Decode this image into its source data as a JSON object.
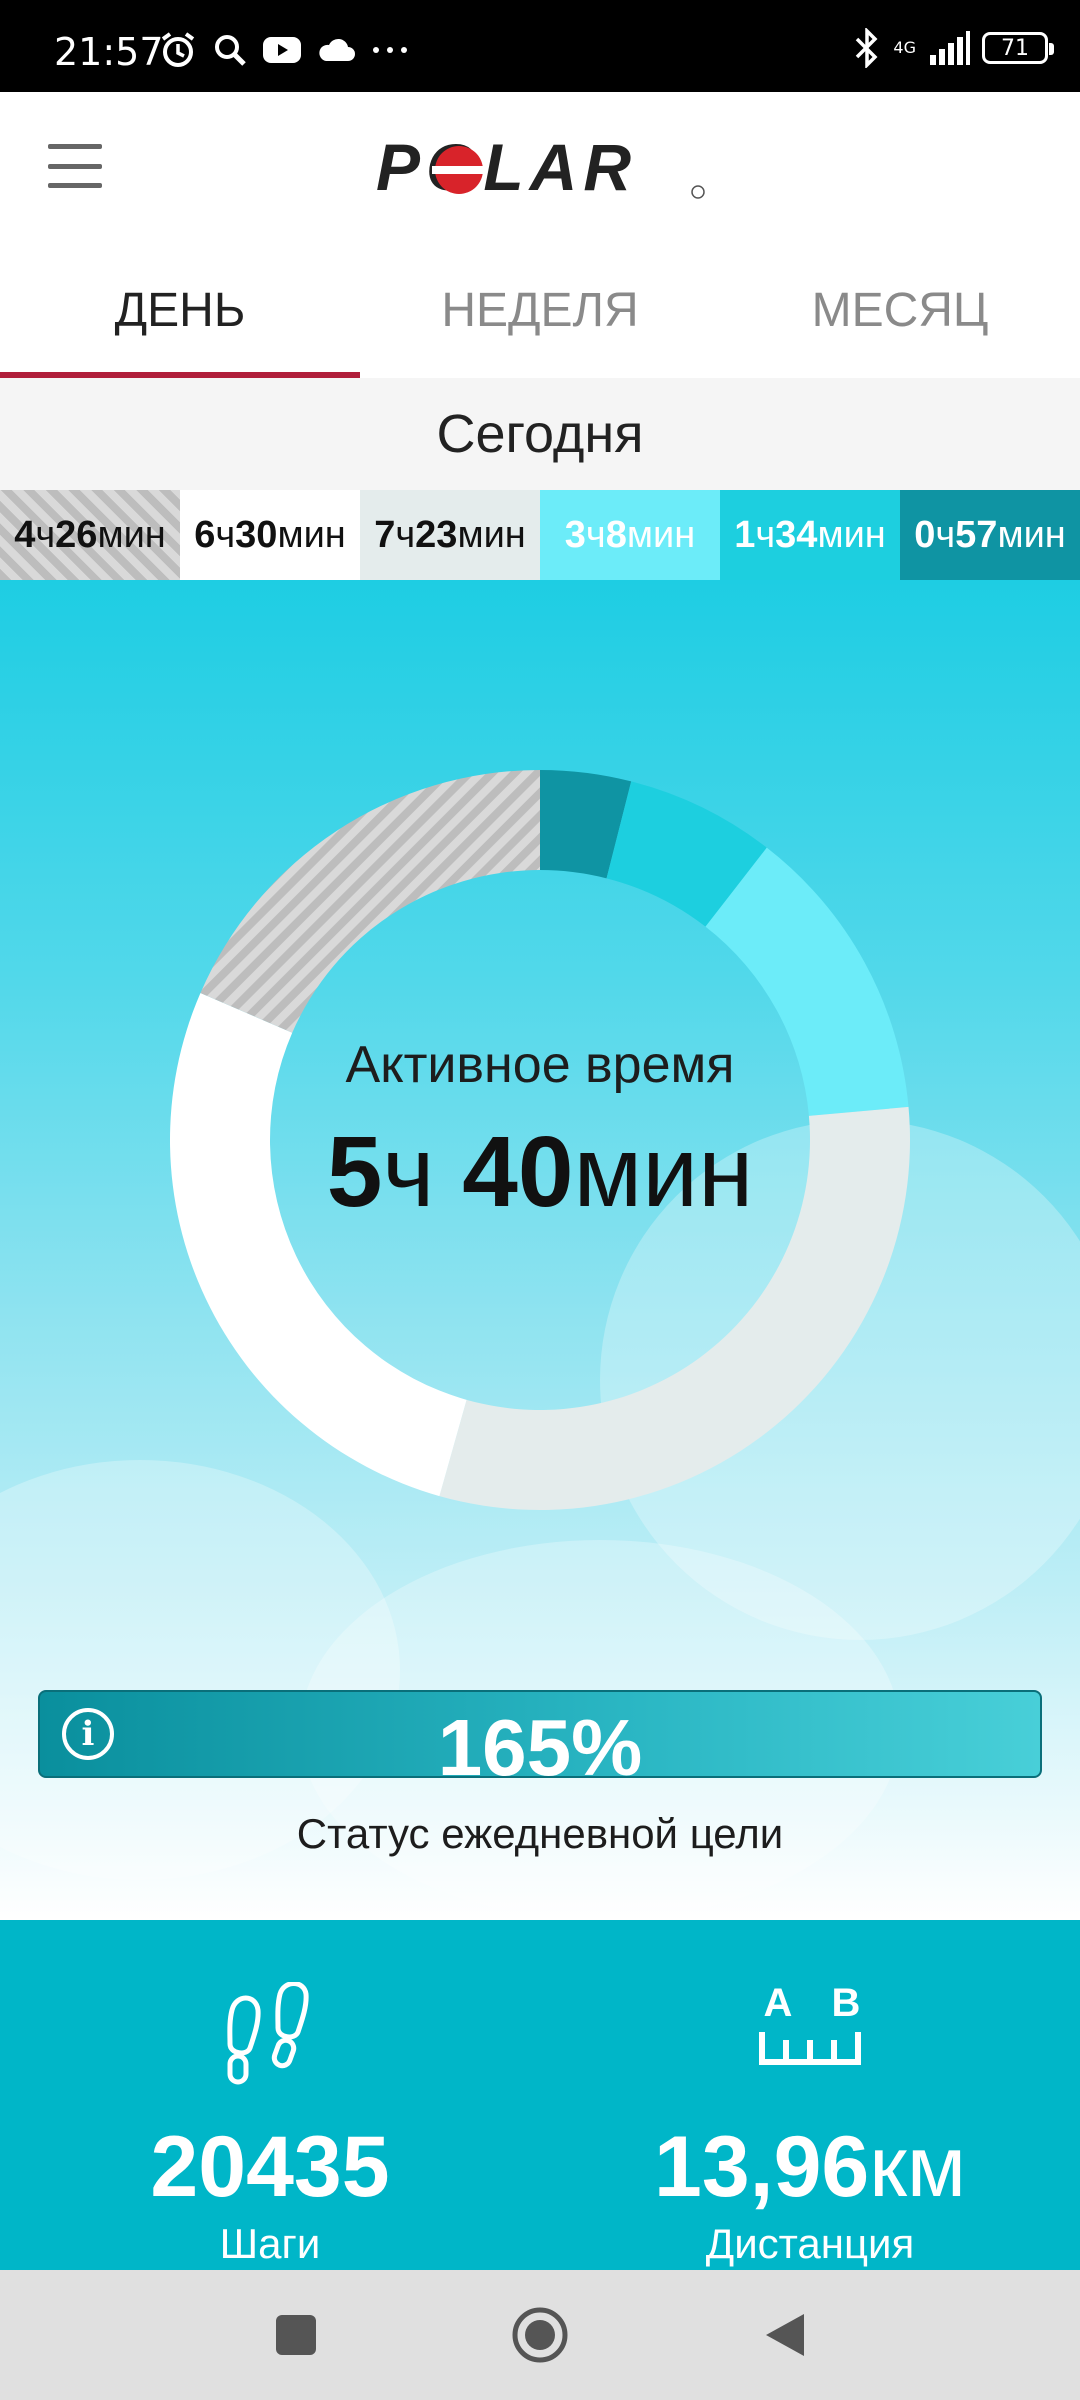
{
  "status_bar": {
    "time": "21:57",
    "network": "4G",
    "battery": "71",
    "icons": [
      "alarm-icon",
      "search-icon",
      "youtube-icon",
      "cloud-icon",
      "more-icon",
      "bluetooth-icon",
      "signal-icon",
      "battery-icon"
    ]
  },
  "app": {
    "logo": "POLAR",
    "menu_icon": "hamburger-menu-icon"
  },
  "tabs": [
    {
      "label": "ДЕНЬ",
      "active": true
    },
    {
      "label": "НЕДЕЛЯ",
      "active": false
    },
    {
      "label": "МЕСЯЦ",
      "active": false
    }
  ],
  "day_label": "Сегодня",
  "zones": [
    {
      "h": "4",
      "hu": "ч",
      "m": "26",
      "mu": "мин"
    },
    {
      "h": "6",
      "hu": "ч",
      "m": "30",
      "mu": "мин"
    },
    {
      "h": "7",
      "hu": "ч",
      "m": "23",
      "mu": "мин"
    },
    {
      "h": "3",
      "hu": "ч",
      "m": "8",
      "mu": "мин"
    },
    {
      "h": "1",
      "hu": "ч",
      "m": "34",
      "mu": "мин"
    },
    {
      "h": "0",
      "hu": "ч",
      "m": "57",
      "mu": "мин"
    }
  ],
  "zone_colors": [
    "#cfcfcf",
    "#ffffff",
    "#e4ecec",
    "#6cecf9",
    "#1dcfdf",
    "#0f94a3"
  ],
  "activity": {
    "label": "Активное время",
    "hours": "5",
    "hours_unit": "ч",
    "minutes": "40",
    "minutes_unit": "мин"
  },
  "goal": {
    "percent": "165%",
    "label": "Статус ежедневной цели"
  },
  "stats": {
    "steps": {
      "value": "20435",
      "label": "Шаги"
    },
    "distance": {
      "value": "13,96",
      "unit": "км",
      "label": "Дистанция",
      "icon_a": "A",
      "icon_b": "B"
    }
  },
  "nav": [
    "recents-button",
    "home-button",
    "back-button"
  ]
}
